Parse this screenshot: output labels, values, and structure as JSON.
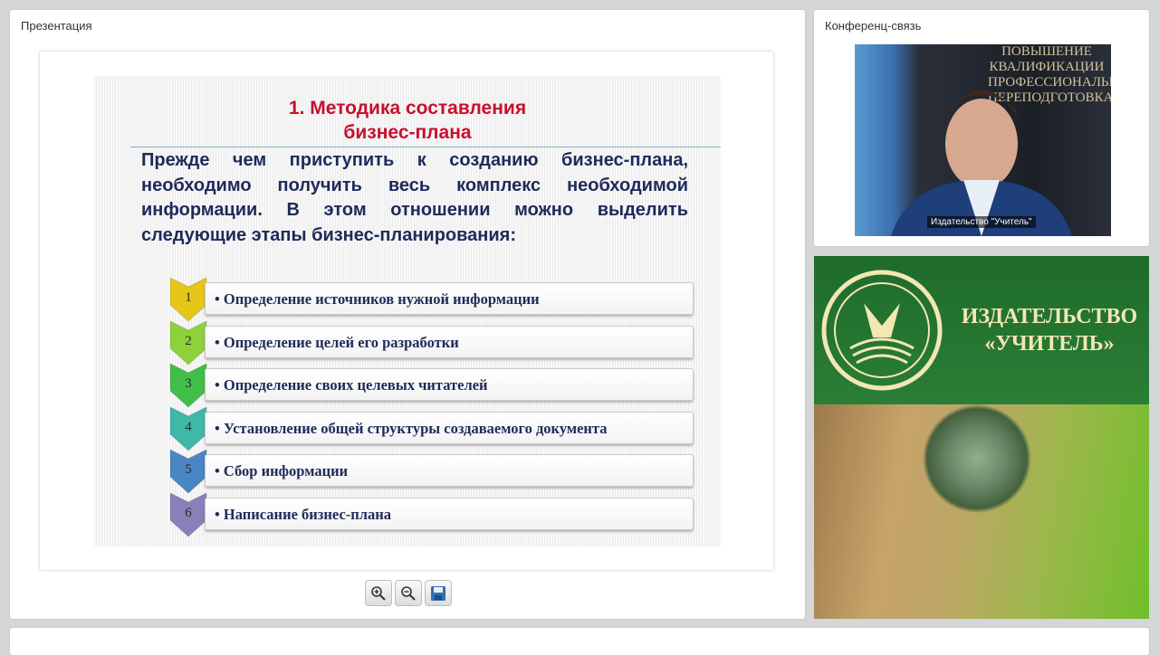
{
  "presentation": {
    "panel_title": "Презентация",
    "slide": {
      "title_line1": "1. Методика составления",
      "title_line2": "бизнес-плана",
      "intro": "Прежде чем приступить к созданию бизнес-плана, необходимо получить весь комплекс необходимой информации. В этом отношении можно выделить следующие этапы бизнес-планирования:",
      "steps": [
        {
          "number": "1",
          "text": "Определение источников нужной информации",
          "color": "#e6c619"
        },
        {
          "number": "2",
          "text": "Определение целей его разработки",
          "color": "#8fd13a"
        },
        {
          "number": "3",
          "text": "Определение своих целевых читателей",
          "color": "#3fbf4a"
        },
        {
          "number": "4",
          "text": "Установление общей структуры создаваемого документа",
          "color": "#3fb8a8"
        },
        {
          "number": "5",
          "text": "Сбор информации",
          "color": "#4a86c4"
        },
        {
          "number": "6",
          "text": "Написание бизнес-плана",
          "color": "#8a7fb8"
        }
      ]
    },
    "toolbar": {
      "zoom_in_icon": "zoom-in-icon",
      "zoom_out_icon": "zoom-out-icon",
      "save_icon": "save-icon"
    }
  },
  "conference": {
    "panel_title": "Конференц-связь",
    "banner_lines": [
      "ПОВЫШЕНИЕ",
      "КВАЛИФИКАЦИИ",
      "ПРОФЕССИОНАЛЬНАЯ",
      "ПЕРЕПОДГОТОВКА"
    ],
    "participant_name": "Издательство \"Учитель\""
  },
  "publisher": {
    "line1": "ИЗДАТЕЛЬСТВО",
    "line2": "«УЧИТЕЛЬ»",
    "accent": "#2a7e35",
    "text_color": "#f3e7b3"
  }
}
